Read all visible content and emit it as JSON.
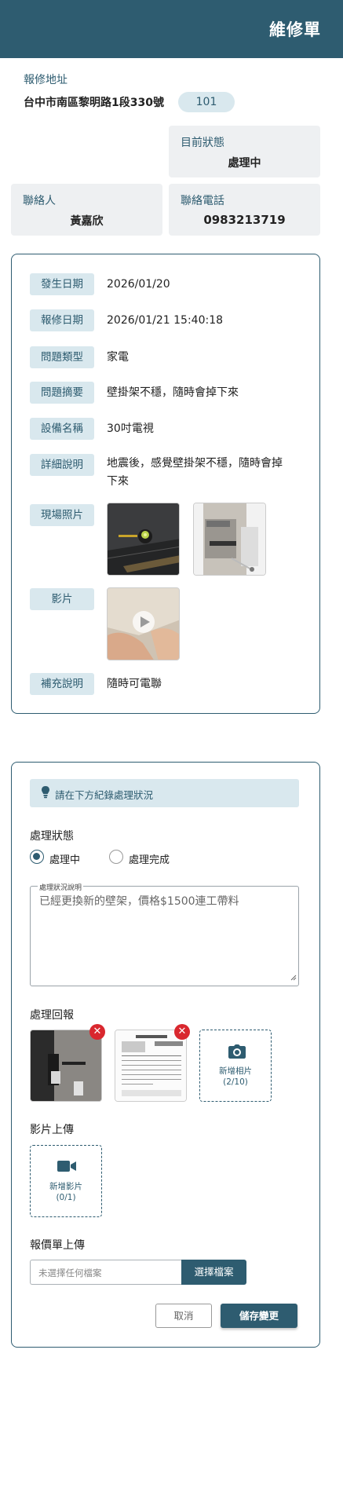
{
  "header": {
    "title": "維修單"
  },
  "address": {
    "label": "報修地址",
    "value": "台中市南區黎明路1段330號",
    "room": "101"
  },
  "status": {
    "label": "目前狀態",
    "value": "處理中"
  },
  "contact": {
    "label": "聯絡人",
    "value": "黃嘉欣"
  },
  "phone": {
    "label": "聯絡電話",
    "value": "0983213719"
  },
  "details": {
    "occur_date": {
      "label": "發生日期",
      "value": "2026/01/20"
    },
    "report_date": {
      "label": "報修日期",
      "value": "2026/01/21 15:40:18"
    },
    "issue_type": {
      "label": "問題類型",
      "value": "家電"
    },
    "summary": {
      "label": "問題摘要",
      "value": "壁掛架不穩，隨時會掉下來"
    },
    "device": {
      "label": "設備名稱",
      "value": "30吋電視"
    },
    "description": {
      "label": "詳細說明",
      "line1": "地震後，感覺壁掛架不穩，隨時會掉",
      "line2": "下來"
    },
    "photos": {
      "label": "現場照片"
    },
    "video": {
      "label": "影片"
    },
    "note": {
      "label": "補充說明",
      "value": "隨時可電聯"
    }
  },
  "form": {
    "hint": "請在下方紀錄處理狀況",
    "status_label": "處理狀態",
    "options": [
      "處理中",
      "處理完成"
    ],
    "selected": "處理中",
    "notes_legend": "處理狀況說明",
    "notes_value": "已經更換新的壁架，價格$1500連工帶料",
    "reply_label": "處理回報",
    "remove_symbol": "✕",
    "add_photo": {
      "label": "新增相片",
      "count": "(2/10)"
    },
    "video_label": "影片上傳",
    "add_video": {
      "label": "新增影片",
      "count": "(0/1)"
    },
    "quote_label": "報價單上傳",
    "file_placeholder": "未選擇任何檔案",
    "file_button": "選擇檔案",
    "cancel": "取消",
    "save": "儲存變更"
  },
  "colors": {
    "primary": "#2e5c70",
    "light": "#d9e8ee",
    "panel": "#eef0f2",
    "danger": "#d9272e"
  }
}
